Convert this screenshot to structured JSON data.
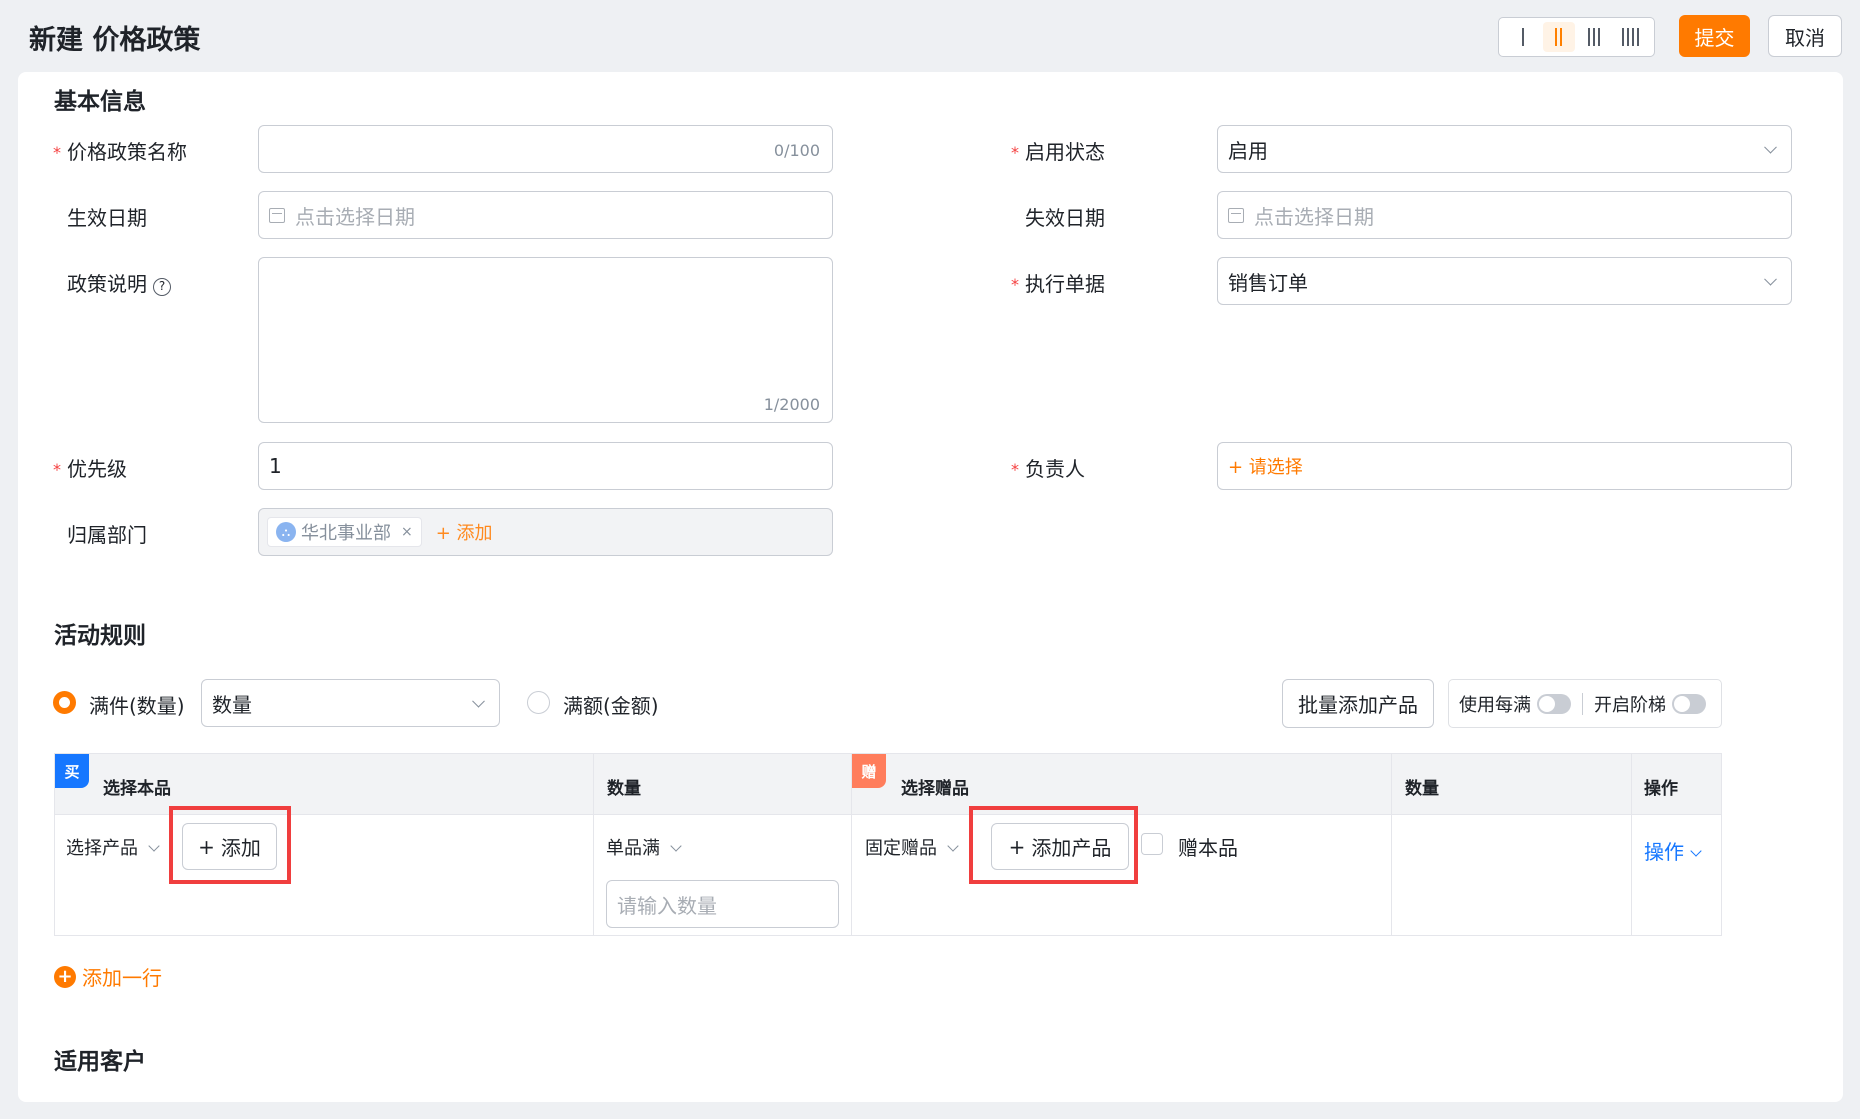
{
  "header": {
    "title": "新建 价格政策",
    "submit_label": "提交",
    "cancel_label": "取消"
  },
  "basic_info": {
    "section_title": "基本信息",
    "policy_name": {
      "label": "价格政策名称",
      "value": "",
      "counter": "0/100"
    },
    "status": {
      "label": "启用状态",
      "value": "启用"
    },
    "effective_date": {
      "label": "生效日期",
      "placeholder": "点击选择日期"
    },
    "expiry_date": {
      "label": "失效日期",
      "placeholder": "点击选择日期"
    },
    "description": {
      "label": "政策说明",
      "help_icon": "?",
      "counter": "1/2000"
    },
    "document": {
      "label": "执行单据",
      "value": "销售订单"
    },
    "priority": {
      "label": "优先级",
      "value": "1"
    },
    "owner": {
      "label": "负责人",
      "add_label": "+ 请选择"
    },
    "department": {
      "label": "归属部门",
      "tag": "华北事业部",
      "tag_close": "×",
      "add_label": "+ 添加"
    }
  },
  "activity_rules": {
    "section_title": "活动规则",
    "mode_count_label": "满件(数量)",
    "mode_count_select": "数量",
    "mode_amount_label": "满额(金额)",
    "batch_add_label": "批量添加产品",
    "use_each_label": "使用每满",
    "enable_tier_label": "开启阶梯",
    "table": {
      "buy_badge": "买",
      "gift_badge": "赠",
      "headers": [
        "选择本品",
        "数量",
        "选择赠品",
        "数量",
        "操作"
      ],
      "row": {
        "product_select": "选择产品",
        "add_label": "添加",
        "qty_mode": "单品满",
        "qty_placeholder": "请输入数量",
        "gift_mode": "固定赠品",
        "add_product_label": "添加产品",
        "gift_self_label": "赠本品",
        "action_label": "操作"
      }
    },
    "add_row_label": "添加一行"
  },
  "customers": {
    "section_title": "适用客户"
  },
  "colors": {
    "accent": "#ff7a00",
    "buy_badge": "#1677ff",
    "gift_badge": "#ff7d5c",
    "highlight": "#f03e3e"
  }
}
